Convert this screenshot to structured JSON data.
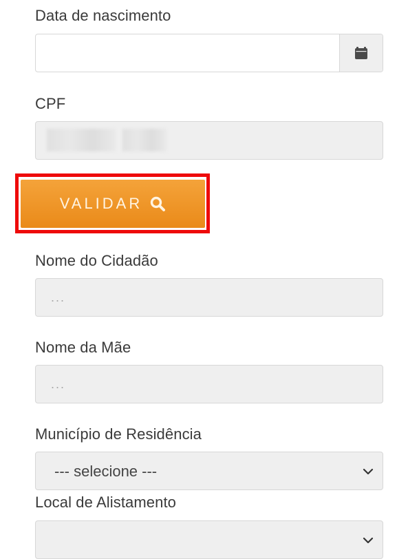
{
  "birth_date": {
    "label": "Data de nascimento",
    "value": "",
    "icon": "calendar-icon"
  },
  "cpf": {
    "label": "CPF"
  },
  "validate": {
    "label": "VALIDAR",
    "icon": "search-icon",
    "highlight_color": "#ee0a0a",
    "button_color": "#ea8a19"
  },
  "citizen_name": {
    "label": "Nome do Cidadão",
    "placeholder": "..."
  },
  "mother_name": {
    "label": "Nome da Mãe",
    "placeholder": "..."
  },
  "municipality": {
    "label": "Município de Residência",
    "selected": "--- selecione ---",
    "icon": "chevron-down-icon"
  },
  "enlistment": {
    "label": "Local de Alistamento",
    "selected": "",
    "icon": "chevron-down-icon"
  }
}
